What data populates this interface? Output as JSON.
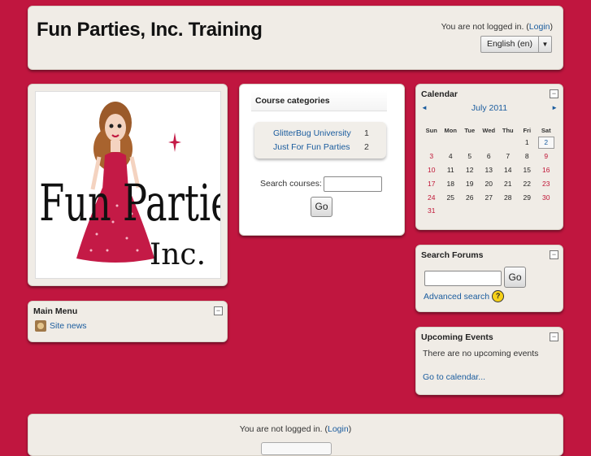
{
  "header": {
    "site_title": "Fun Parties, Inc. Training",
    "login_prefix": "You are not logged in. (",
    "login_link": "Login",
    "login_suffix": ")",
    "language": "English (en)"
  },
  "logo": {
    "text_line1": "Fun Parties,",
    "text_line2": "Inc."
  },
  "main_menu": {
    "title": "Main Menu",
    "items": [
      {
        "label": "Site news",
        "icon": "news-icon"
      }
    ]
  },
  "course_categories": {
    "title": "Course categories",
    "categories": [
      {
        "name": "GlitterBug University",
        "count": "1"
      },
      {
        "name": "Just For Fun Parties",
        "count": "2"
      }
    ],
    "search_label": "Search courses:",
    "go_label": "Go"
  },
  "calendar": {
    "title": "Calendar",
    "month": "July 2011",
    "prev": "◄",
    "next": "►",
    "weekdays": [
      "Sun",
      "Mon",
      "Tue",
      "Wed",
      "Thu",
      "Fri",
      "Sat"
    ],
    "weeks": [
      [
        "",
        "",
        "",
        "",
        "",
        "1",
        "2"
      ],
      [
        "3",
        "4",
        "5",
        "6",
        "7",
        "8",
        "9"
      ],
      [
        "10",
        "11",
        "12",
        "13",
        "14",
        "15",
        "16"
      ],
      [
        "17",
        "18",
        "19",
        "20",
        "21",
        "22",
        "23"
      ],
      [
        "24",
        "25",
        "26",
        "27",
        "28",
        "29",
        "30"
      ],
      [
        "31",
        "",
        "",
        "",
        "",
        "",
        ""
      ]
    ],
    "today": "2",
    "weekend_color": "#c01536"
  },
  "search_forums": {
    "title": "Search Forums",
    "go_label": "Go",
    "advanced_label": "Advanced search",
    "help_icon": "?"
  },
  "upcoming_events": {
    "title": "Upcoming Events",
    "empty_text": "There are no upcoming events",
    "link": "Go to calendar..."
  },
  "footer": {
    "login_prefix": "You are not logged in. (",
    "login_link": "Login",
    "login_suffix": ")"
  },
  "colors": {
    "background": "#c0163f",
    "panel": "#f0ece6",
    "link": "#1a5c9e"
  }
}
